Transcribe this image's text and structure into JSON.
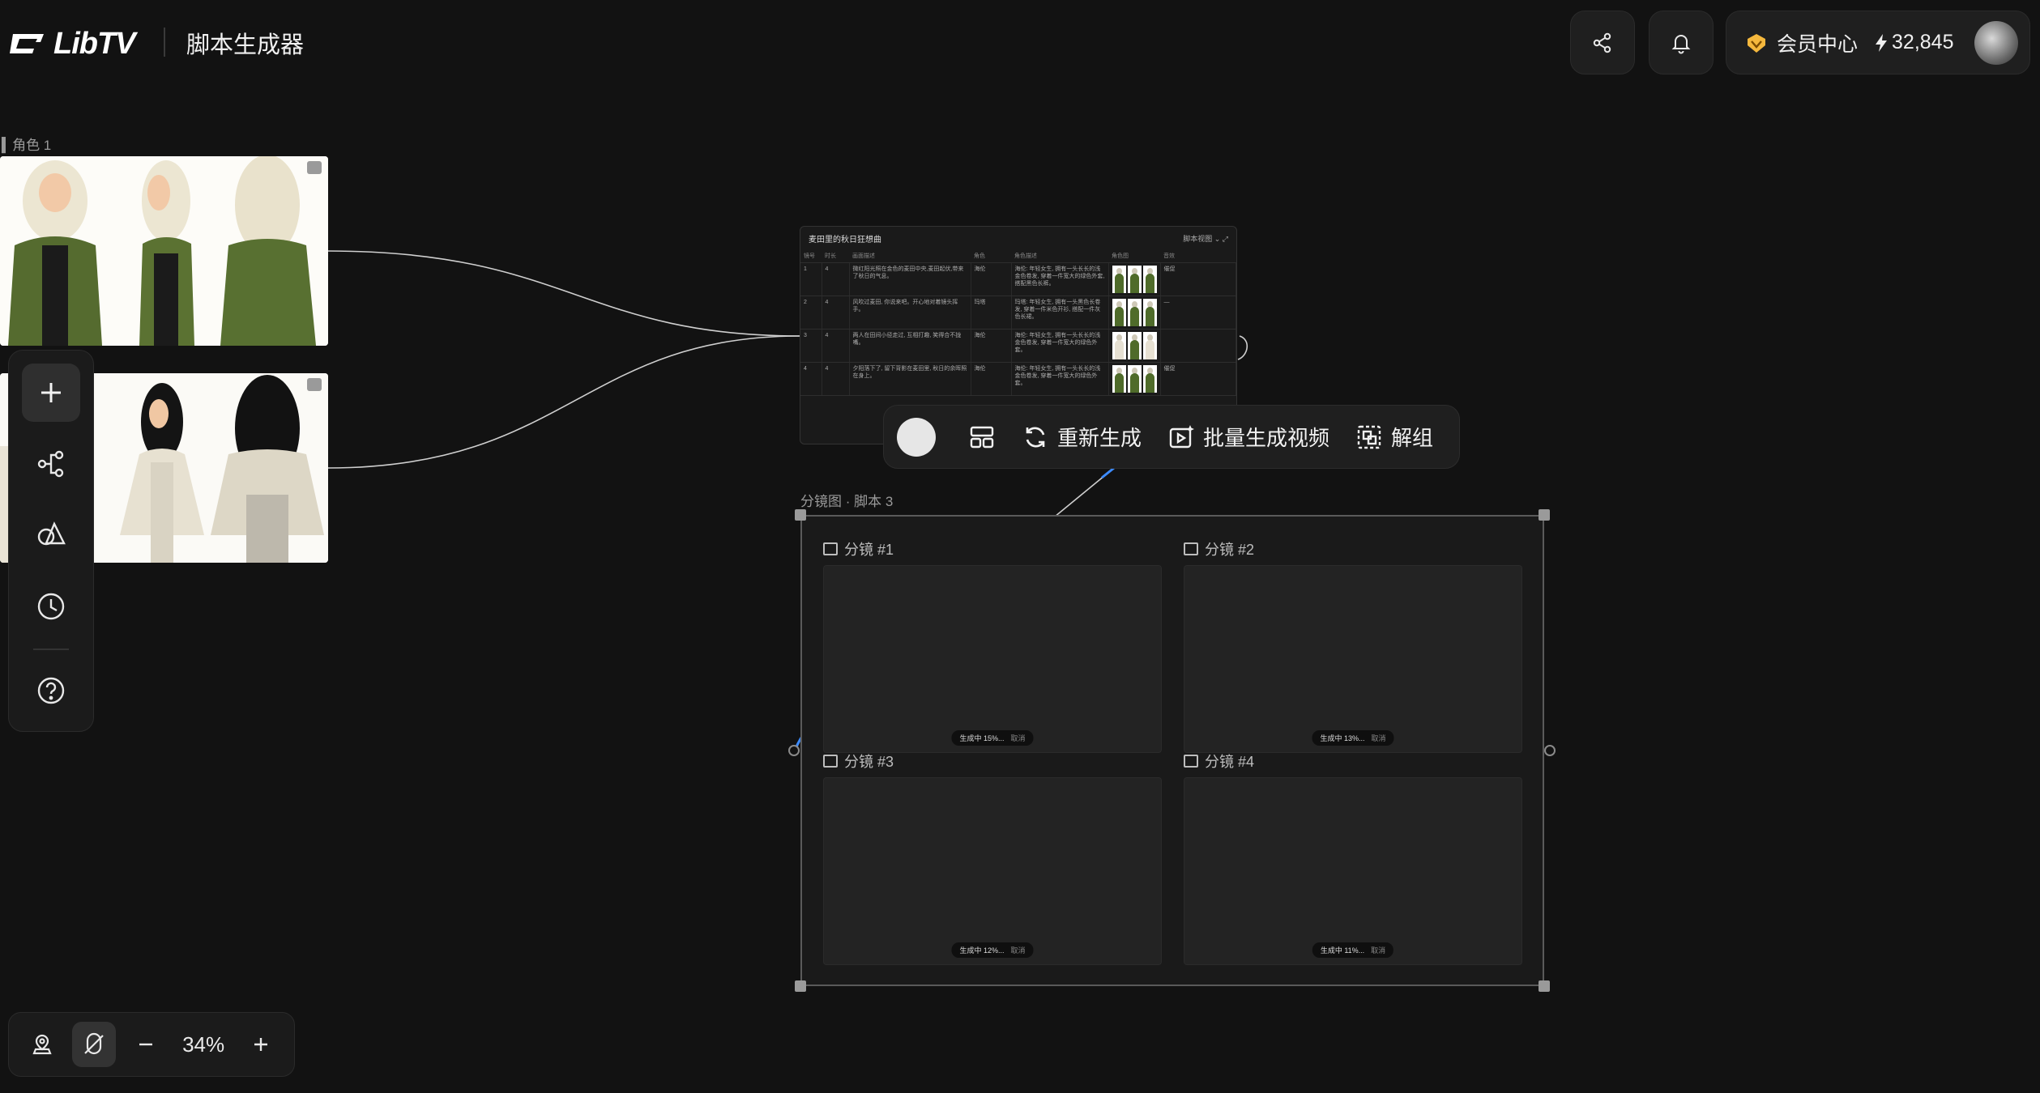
{
  "app": {
    "logo_text": "LibTV",
    "title": "脚本生成器"
  },
  "header": {
    "member_label": "会员中心",
    "credits": "32,845"
  },
  "characters": [
    {
      "label": "角色 1"
    }
  ],
  "script_table": {
    "title": "麦田里的秋日狂想曲",
    "view_mode": "脚本视图",
    "columns": [
      "镜号",
      "时长",
      "画面描述",
      "角色",
      "角色描述",
      "角色图",
      "音效"
    ],
    "rows": [
      {
        "no": "1",
        "dur": "4",
        "desc": "微红阳光照在金色的麦田中央,麦田起伏,带来了秋日的气息。",
        "role": "海伦",
        "role_desc": "海伦: 年轻女生, 拥有一头长长的浅金色卷发, 穿着一件宽大的绿色外套, 搭配黑色长裤。",
        "sound": "催促"
      },
      {
        "no": "2",
        "dur": "4",
        "desc": "风吹过麦田, 你说来吧。开心地对着镜头挥手。",
        "role": "玛塔",
        "role_desc": "玛塔: 年轻女生, 拥有一头黑色长卷发, 穿着一件米色开衫, 搭配一件灰色长裙。",
        "sound": "—"
      },
      {
        "no": "3",
        "dur": "4",
        "desc": "两人在田间小径走过, 互相打趣, 笑得合不拢嘴。",
        "role": "海伦",
        "role_desc": "海伦: 年轻女生, 拥有一头长长的浅金色卷发, 穿着一件宽大的绿色外套。",
        "sound": ""
      },
      {
        "no": "4",
        "dur": "4",
        "desc": "夕阳落下了, 留下背影在麦田里, 秋日的余晖照在身上。",
        "role": "海伦",
        "role_desc": "海伦: 年轻女生, 拥有一头长长的浅金色卷发, 穿着一件宽大的绿色外套。",
        "sound": "催促"
      }
    ]
  },
  "float_toolbar": {
    "regen": "重新生成",
    "batch_video": "批量生成视频",
    "ungroup": "解组"
  },
  "storyboard": {
    "label": "分镜图 · 脚本 3",
    "shots": [
      {
        "title": "分镜 #1",
        "status": "生成中 15%...",
        "cancel": "取消"
      },
      {
        "title": "分镜 #2",
        "status": "生成中 13%...",
        "cancel": "取消"
      },
      {
        "title": "分镜 #3",
        "status": "生成中 12%...",
        "cancel": "取消"
      },
      {
        "title": "分镜 #4",
        "status": "生成中 11%...",
        "cancel": "取消"
      }
    ]
  },
  "zoom": {
    "value": "34%"
  },
  "colors": {
    "bg": "#121212",
    "panel": "#1f1f1f",
    "jacket_green": "#4f6b2a",
    "accent_gold": "#f5b83d"
  }
}
